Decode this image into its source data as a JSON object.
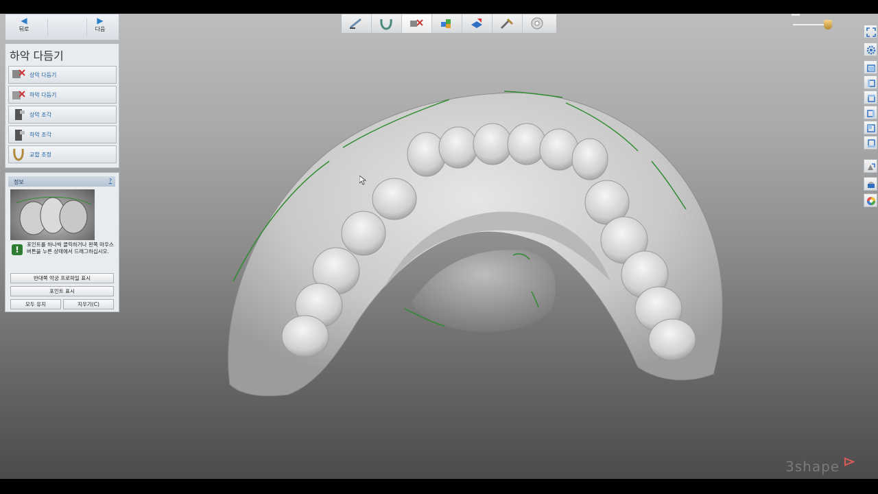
{
  "nav": {
    "back_label": "뒤로",
    "next_label": "다음"
  },
  "panel": {
    "title": "하악 다듬기",
    "steps": [
      {
        "label": "상악 다듬기",
        "icon": "upper-trim-icon"
      },
      {
        "label": "하악 다듬기",
        "icon": "lower-trim-icon"
      },
      {
        "label": "상악 조각",
        "icon": "upper-sculpt-icon"
      },
      {
        "label": "하악 조각",
        "icon": "lower-sculpt-icon"
      },
      {
        "label": "교합 조정",
        "icon": "occlusion-icon"
      }
    ]
  },
  "info": {
    "header": "정보",
    "help": "?",
    "tip": "포인트를 하나씩 클릭하거나 왼쪽 마우스 버튼을 누른 상태에서 드래그하십시오.",
    "buttons": {
      "show_opposing": "반대쪽 악궁 프로파일 표시",
      "show_points": "포인트 표시",
      "keep_all": "모두 유지",
      "clear": "지우기(C)"
    }
  },
  "toolbar": {
    "tools": [
      "scan-tool-icon",
      "arch-icon",
      "trim-tool-icon",
      "blocks-icon",
      "model-base-icon",
      "sculpt-tool-icon",
      "disc-icon"
    ],
    "active_index": 2
  },
  "right_sidebar": {
    "items": [
      "fullscreen-icon",
      "settings-gear-icon",
      "view-front-icon",
      "view-left-icon",
      "view-top-icon",
      "view-right-icon",
      "view-back-icon",
      "view-bottom-icon",
      "model-toggle-icon",
      "jaw-toggle-icon",
      "color-wheel-icon"
    ]
  },
  "brand": {
    "name": "3shape",
    "accent_color": "#e05a5a"
  },
  "colors": {
    "accent_blue": "#1d5fa8",
    "margin_line_green": "#2e8b2e"
  }
}
